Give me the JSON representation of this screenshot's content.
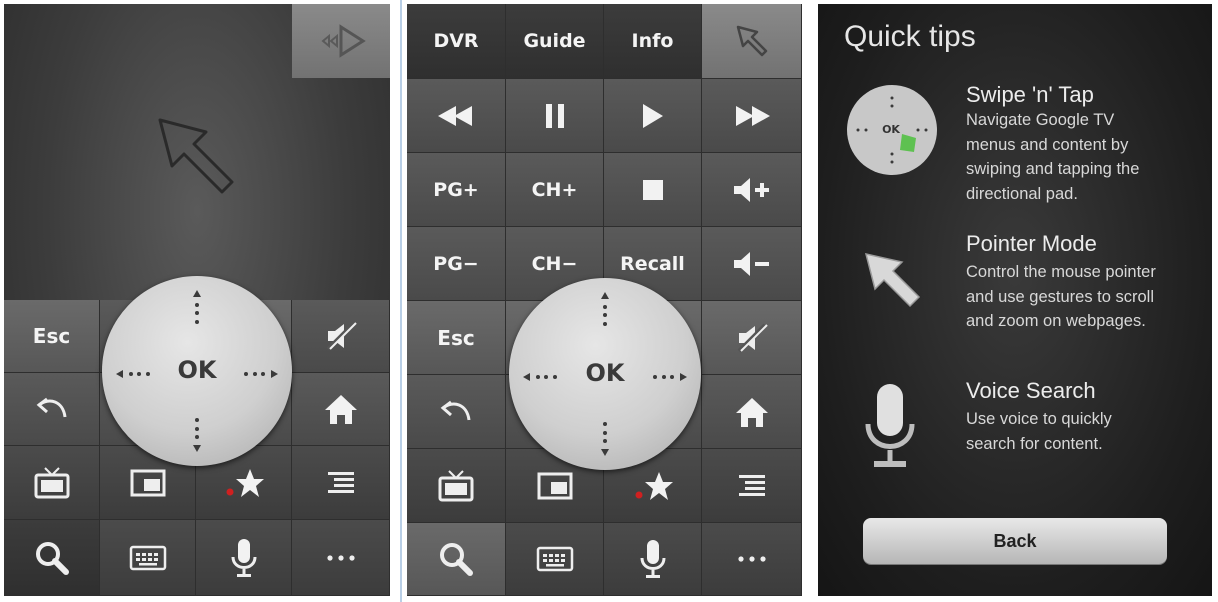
{
  "remote": {
    "text_buttons": {
      "dvr": "DVR",
      "guide": "Guide",
      "info": "Info",
      "pg_up": "PG+",
      "ch_up": "CH+",
      "pg_down": "PG−",
      "ch_down": "CH−",
      "recall": "Recall",
      "esc": "Esc"
    },
    "ok_label": "OK"
  },
  "tips": {
    "title": "Quick tips",
    "items": [
      {
        "heading": "Swipe 'n' Tap",
        "body": [
          "Navigate Google TV",
          "menus and content by",
          "swiping and tapping the",
          "directional pad."
        ],
        "icon": "dpad-icon",
        "icon_label": "OK"
      },
      {
        "heading": "Pointer Mode",
        "body": [
          "Control the mouse pointer",
          "and use gestures to scroll",
          "and zoom on webpages."
        ],
        "icon": "pointer-icon"
      },
      {
        "heading": "Voice Search",
        "body": [
          "Use voice to quickly",
          "search for content."
        ],
        "icon": "microphone-icon"
      }
    ],
    "back_label": "Back"
  }
}
